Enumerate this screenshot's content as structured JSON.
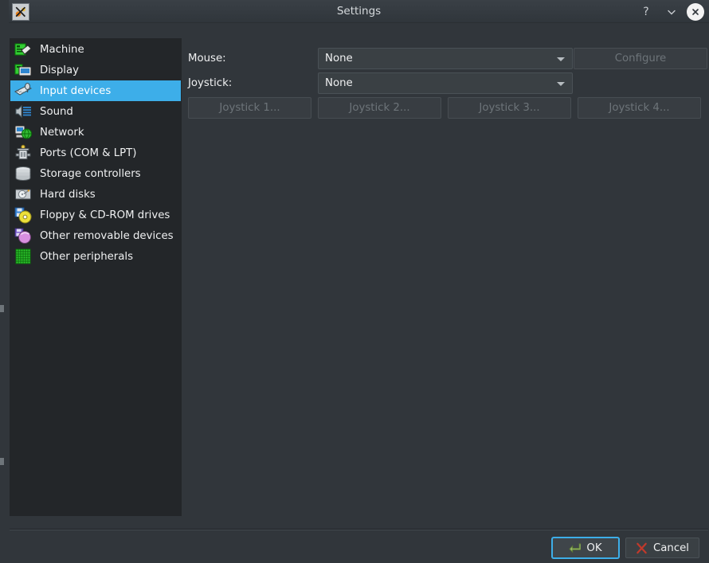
{
  "window": {
    "title": "Settings",
    "icon": "x-app-icon",
    "controls": [
      {
        "name": "help-button",
        "label": "?"
      },
      {
        "name": "window-menu-button",
        "label": "∨"
      },
      {
        "name": "close-button",
        "label": "✕"
      }
    ]
  },
  "sidebar": {
    "selected_index": 2,
    "items": [
      {
        "label": "Machine",
        "icon": "machine-icon"
      },
      {
        "label": "Display",
        "icon": "display-icon"
      },
      {
        "label": "Input devices",
        "icon": "input-devices-icon"
      },
      {
        "label": "Sound",
        "icon": "sound-icon"
      },
      {
        "label": "Network",
        "icon": "network-icon"
      },
      {
        "label": "Ports (COM & LPT)",
        "icon": "ports-icon"
      },
      {
        "label": "Storage controllers",
        "icon": "storage-controllers-icon"
      },
      {
        "label": "Hard disks",
        "icon": "hard-disks-icon"
      },
      {
        "label": "Floppy & CD-ROM drives",
        "icon": "floppy-cdrom-icon"
      },
      {
        "label": "Other removable devices",
        "icon": "other-removable-icon"
      },
      {
        "label": "Other peripherals",
        "icon": "other-peripherals-icon"
      }
    ]
  },
  "main": {
    "mouse": {
      "label": "Mouse:",
      "value": "None",
      "configure_label": "Configure"
    },
    "joystick": {
      "label": "Joystick:",
      "value": "None",
      "buttons": [
        "Joystick 1...",
        "Joystick 2...",
        "Joystick 3...",
        "Joystick 4..."
      ]
    }
  },
  "footer": {
    "ok_label": "OK",
    "cancel_label": "Cancel"
  },
  "colors": {
    "accent": "#3daee9",
    "window_bg": "#31363b",
    "list_bg": "#232629",
    "text": "#eff0f1",
    "disabled_text": "#6d7479"
  }
}
